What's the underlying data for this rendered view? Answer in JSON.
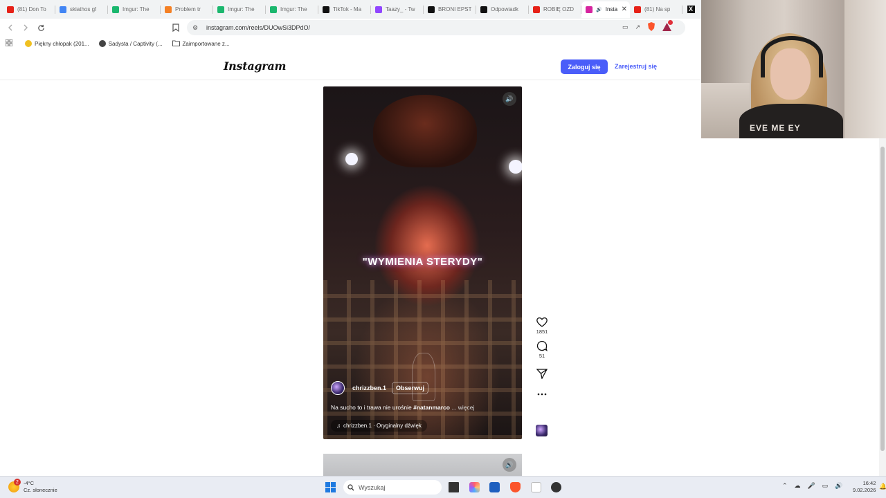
{
  "browser": {
    "tabs": [
      {
        "title": "(81) Don To",
        "icon": "youtube-icon",
        "color": "#e62117"
      },
      {
        "title": "skiathos gf",
        "icon": "google-icon",
        "color": "#4285f4"
      },
      {
        "title": "Imgur: The",
        "icon": "imgur-icon",
        "color": "#1bb76e"
      },
      {
        "title": "Problem tr",
        "icon": "stack-icon",
        "color": "#f48024"
      },
      {
        "title": "Imgur: The",
        "icon": "imgur-icon",
        "color": "#1bb76e"
      },
      {
        "title": "Imgur: The",
        "icon": "imgur-icon",
        "color": "#1bb76e"
      },
      {
        "title": "TikTok - Ma",
        "icon": "tiktok-icon",
        "color": "#111111"
      },
      {
        "title": "Taazy_ - Tw",
        "icon": "twitch-icon",
        "color": "#9146ff"
      },
      {
        "title": "BRONI EPST",
        "icon": "tiktok-icon",
        "color": "#111111"
      },
      {
        "title": "Odpowiadk",
        "icon": "tiktok-icon",
        "color": "#111111"
      },
      {
        "title": "ROBIĘ OZD",
        "icon": "youtube-icon",
        "color": "#e62117"
      },
      {
        "title": "Insta",
        "icon": "instagram-icon",
        "color": "#d6249f",
        "active": true
      },
      {
        "title": "(81) Na sp",
        "icon": "youtube-icon",
        "color": "#e62117"
      }
    ],
    "url": "instagram.com/reels/DUOwSi3DPdO/",
    "bookmarks": [
      {
        "label": "Piękny chłopak (201..."
      },
      {
        "label": "Sadysta / Captivity (..."
      },
      {
        "label": "Zaimportowane z..."
      }
    ]
  },
  "instagram": {
    "logo": "Instagram",
    "login": "Zaloguj się",
    "signup": "Zarejestruj się",
    "reel": {
      "overlay_text": "\"WYMIENIA STERYDY\"",
      "author": "chrizzben.1",
      "follow": "Obserwuj",
      "desc_text": "Na sucho to i trawa nie urośnie ",
      "desc_tag": "#natanmarco",
      "desc_more": " ... więcej",
      "audio": "chrizzben.1 · Oryginalny dźwięk",
      "likes": "1851",
      "comments": "51"
    }
  },
  "webcam": {
    "shirt_text": "EVE ME EY"
  },
  "taskbar": {
    "weather_badge": "2",
    "temperature": "-4°C",
    "weather_desc": "Cz. słonecznie",
    "search_placeholder": "Wyszukaj",
    "time": "16:42",
    "date": "9.02.2026"
  }
}
